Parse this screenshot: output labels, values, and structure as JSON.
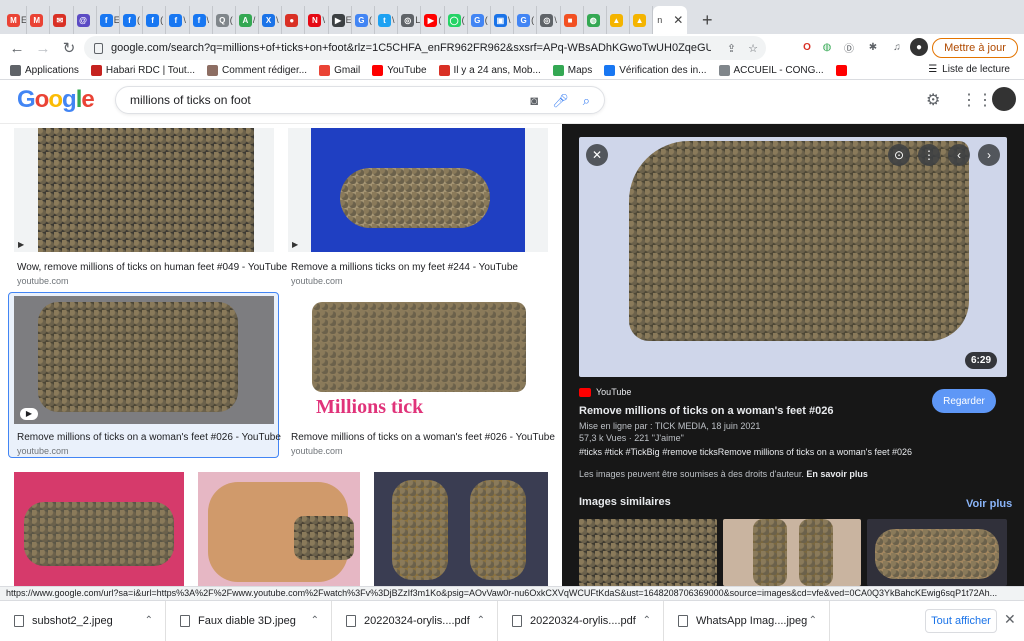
{
  "tabs": [
    {
      "label": "E",
      "icon": "gmail-icon",
      "color": "#ea4335",
      "glyph": "M"
    },
    {
      "label": "",
      "icon": "gmail-icon",
      "color": "#ea4335",
      "glyph": "M"
    },
    {
      "label": "",
      "icon": "mail-icon",
      "color": "#d93025",
      "glyph": "✉"
    },
    {
      "label": "",
      "icon": "at-icon",
      "color": "#5b4bc4",
      "glyph": "@"
    },
    {
      "label": "E",
      "icon": "facebook-icon",
      "color": "#1877f2",
      "glyph": "f"
    },
    {
      "label": "(",
      "icon": "facebook-icon",
      "color": "#1877f2",
      "glyph": "f"
    },
    {
      "label": "(",
      "icon": "facebook-icon",
      "color": "#1877f2",
      "glyph": "f"
    },
    {
      "label": "\\",
      "icon": "facebook-icon",
      "color": "#1877f2",
      "glyph": "f"
    },
    {
      "label": "\\",
      "icon": "facebook-icon",
      "color": "#1877f2",
      "glyph": "f"
    },
    {
      "label": "(",
      "icon": "search-icon",
      "color": "#80868b",
      "glyph": "Q"
    },
    {
      "label": "/",
      "icon": "translate-icon",
      "color": "#34a853",
      "glyph": "A"
    },
    {
      "label": "\\",
      "icon": "x-icon",
      "color": "#1a73e8",
      "glyph": "X"
    },
    {
      "label": "",
      "icon": "mushroom-icon",
      "color": "#d93025",
      "glyph": "●"
    },
    {
      "label": "\\",
      "icon": "netflix-icon",
      "color": "#e50914",
      "glyph": "N"
    },
    {
      "label": "E",
      "icon": "play-icon",
      "color": "#3c4043",
      "glyph": "▶"
    },
    {
      "label": "(",
      "icon": "google-icon",
      "color": "#4285f4",
      "glyph": "G"
    },
    {
      "label": "\\",
      "icon": "twitter-icon",
      "color": "#1da1f2",
      "glyph": "t"
    },
    {
      "label": "L",
      "icon": "globe-icon",
      "color": "#5f6368",
      "glyph": "◎"
    },
    {
      "label": "(",
      "icon": "youtube-icon",
      "color": "#ff0000",
      "glyph": "▶"
    },
    {
      "label": "(",
      "icon": "whatsapp-icon",
      "color": "#25d366",
      "glyph": "◯"
    },
    {
      "label": "(",
      "icon": "google-icon",
      "color": "#4285f4",
      "glyph": "G"
    },
    {
      "label": "\\",
      "icon": "image-icon",
      "color": "#1a73e8",
      "glyph": "▣"
    },
    {
      "label": "(",
      "icon": "google-icon",
      "color": "#4285f4",
      "glyph": "G"
    },
    {
      "label": "\\",
      "icon": "globe-icon",
      "color": "#5f6368",
      "glyph": "◎"
    },
    {
      "label": "",
      "icon": "microsoft-icon",
      "color": "#f25022",
      "glyph": "■"
    },
    {
      "label": "",
      "icon": "covid-icon",
      "color": "#34a853",
      "glyph": "◍"
    },
    {
      "label": "",
      "icon": "pyramid-icon",
      "color": "#f4b400",
      "glyph": "▲"
    },
    {
      "label": "",
      "icon": "pyramid-icon",
      "color": "#f4b400",
      "glyph": "▲"
    }
  ],
  "active_tab": {
    "label": "n",
    "icon": "image-icon"
  },
  "omnibox": {
    "url": "google.com/search?q=millions+of+ticks+on+foot&rlz=1C5CHFA_enFR962FR962&sxsrf=APq-WBsADhKGwoTwUH0ZqeGUzzAQQPHEX..."
  },
  "update_label": "Mettre à jour",
  "bookmarks": [
    {
      "label": "Applications",
      "icon": "apps-icon",
      "color": "#5f6368"
    },
    {
      "label": "Habari RDC | Tout...",
      "icon": "habari-icon",
      "color": "#c5221f"
    },
    {
      "label": "Comment rédiger...",
      "icon": "doc-icon",
      "color": "#8d6e63"
    },
    {
      "label": "Gmail",
      "icon": "gmail-icon",
      "color": "#ea4335"
    },
    {
      "label": "YouTube",
      "icon": "youtube-icon",
      "color": "#ff0000"
    },
    {
      "label": "Il y a 24 ans, Mob...",
      "icon": "flag-icon",
      "color": "#d93025"
    },
    {
      "label": "Maps",
      "icon": "maps-icon",
      "color": "#34a853"
    },
    {
      "label": "Vérification des in...",
      "icon": "facebook-icon",
      "color": "#1877f2"
    },
    {
      "label": "ACCUEIL - CONG...",
      "icon": "search-icon",
      "color": "#80868b"
    },
    {
      "label": "",
      "icon": "youtube-icon",
      "color": "#ff0000"
    }
  ],
  "reading_list": "Liste de lecture",
  "google": {
    "logo": "Google",
    "query": "millions of ticks on foot"
  },
  "results": [
    {
      "title": "Wow, remove millions of ticks on human feet #049 - YouTube",
      "source": "youtube.com"
    },
    {
      "title": "Remove a millions ticks on my feet #244 - YouTube",
      "source": "youtube.com"
    },
    {
      "title": "Remove millions of ticks on a woman's feet #026 - YouTube",
      "source": "youtube.com"
    },
    {
      "title": "Remove millions of ticks on a woman's feet #026 - YouTube",
      "source": "youtube.com",
      "overlay": "Millions tick"
    }
  ],
  "panel": {
    "duration": "6:29",
    "site": "YouTube",
    "title": "Remove millions of ticks on a woman's feet #026",
    "uploaded": "Mise en ligne par : TICK MEDIA, 18 juin 2021",
    "views": "57,3 k Vues",
    "likes": "221 \"J'aime\"",
    "tags": "#ticks #tick #TickBig #remove ticksRemove millions of ticks on a woman's feet #026",
    "copyright": "Les images peuvent être soumises à des droits d'auteur.",
    "learn_more": "En savoir plus",
    "watch": "Regarder",
    "similar": "Images similaires",
    "see_all": "Voir plus"
  },
  "status_url": "https://www.google.com/url?sa=i&url=https%3A%2F%2Fwww.youtube.com%2Fwatch%3Fv%3DjBZzIf3m1Ko&psig=AOvVaw0r-nu6OxkCXVqWCUFtKdaS&ust=1648208706369000&source=images&cd=vfe&ved=0CA0Q3YkBahcKEwig6sqP1t72Ah...",
  "downloads": [
    {
      "name": "subshot2_2.jpeg"
    },
    {
      "name": "Faux diable 3D.jpeg"
    },
    {
      "name": "20220324-orylis....pdf"
    },
    {
      "name": "20220324-orylis....pdf"
    },
    {
      "name": "WhatsApp Imag....jpeg"
    }
  ],
  "show_all": "Tout afficher"
}
